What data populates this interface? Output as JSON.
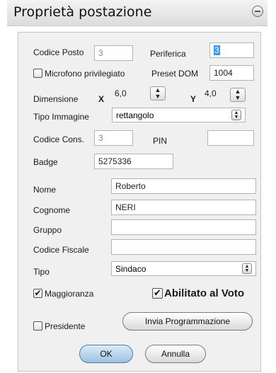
{
  "dialog": {
    "title": "Proprietà postazione"
  },
  "codice_posto": {
    "label": "Codice Posto",
    "value": "3"
  },
  "periferica": {
    "label": "Periferica",
    "value": "3"
  },
  "microfono": {
    "label": "Microfono privilegiato",
    "checked": false
  },
  "preset_dom": {
    "label": "Preset DOM",
    "value": "1004"
  },
  "dimensione": {
    "label": "Dimensione",
    "x_label": "X",
    "x_value": "6,0",
    "y_label": "Y",
    "y_value": "4,0"
  },
  "tipo_immagine": {
    "label": "Tipo Immagine",
    "value": "rettangolo"
  },
  "codice_cons": {
    "label": "Codice Cons.",
    "value": "3"
  },
  "pin": {
    "label": "PIN",
    "value": ""
  },
  "badge": {
    "label": "Badge",
    "value": "5275336"
  },
  "nome": {
    "label": "Nome",
    "value": "Roberto"
  },
  "cognome": {
    "label": "Cognome",
    "value": "NERI"
  },
  "gruppo": {
    "label": "Gruppo",
    "value": ""
  },
  "codice_fiscale": {
    "label": "Codice Fiscale",
    "value": ""
  },
  "tipo": {
    "label": "Tipo",
    "value": "Sindaco"
  },
  "maggioranza": {
    "label": "Maggioranza",
    "checked": true
  },
  "abilitato": {
    "label": "Abilitato al Voto",
    "checked": true
  },
  "presidente": {
    "label": "Presidente",
    "checked": false
  },
  "buttons": {
    "invia": "Invia Programmazione",
    "ok": "OK",
    "annulla": "Annulla"
  }
}
